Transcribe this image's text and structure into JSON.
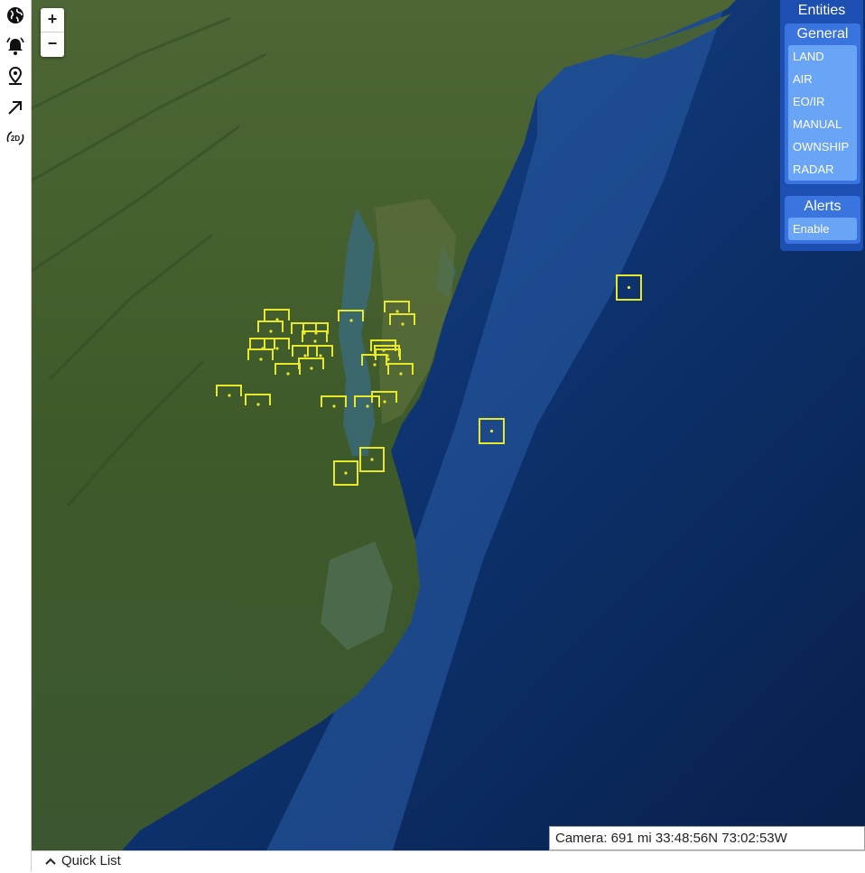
{
  "toolbar": {
    "tools": [
      {
        "icon": "globe-icon"
      },
      {
        "icon": "alarm-bell-icon"
      },
      {
        "icon": "map-pin-icon"
      },
      {
        "icon": "arrow-diagonal-icon"
      },
      {
        "icon": "2d-view-icon",
        "label": "2D"
      }
    ]
  },
  "zoom": {
    "in_label": "+",
    "out_label": "−"
  },
  "entities": {
    "title": "Entities",
    "general": {
      "title": "General",
      "items": [
        "LAND",
        "AIR",
        "EO/IR",
        "MANUAL",
        "OWNSHIP",
        "RADAR"
      ]
    },
    "alerts": {
      "title": "Alerts",
      "items": [
        "Enable"
      ]
    }
  },
  "camera": {
    "text": "Camera: 691 mi 33:48:56N 73:02:53W"
  },
  "quick_list": {
    "label": "Quick List",
    "icon": "chevron-up-icon"
  },
  "colors": {
    "marker": "#e8e82a",
    "panel": "#1d4fb2",
    "group": "#3a74df",
    "group_body": "#6aa4f7",
    "ocean": "#0b2a5a",
    "land": "#3f5a2a"
  }
}
